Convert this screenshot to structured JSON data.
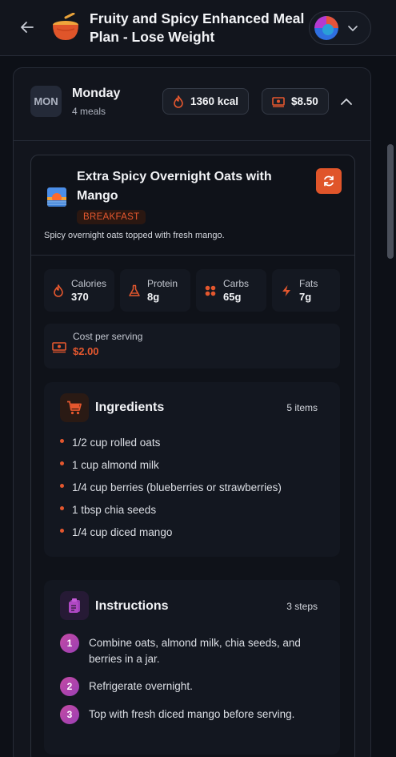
{
  "header": {
    "title": "Fruity and Spicy Enhanced Meal Plan - Lose Weight",
    "back_icon": "arrow-left-icon",
    "app_icon": "bowl-icon"
  },
  "day": {
    "badge": "MON",
    "name": "Monday",
    "meals": "4 meals",
    "calories": "1360 kcal",
    "cost": "$8.50"
  },
  "meal": {
    "title": "Extra Spicy Overnight Oats with Mango",
    "type": "BREAKFAST",
    "description": "Spicy overnight oats topped with fresh mango.",
    "stats": [
      {
        "label": "Calories",
        "value": "370",
        "icon": "flame-icon"
      },
      {
        "label": "Protein",
        "value": "8g",
        "icon": "flask-icon"
      },
      {
        "label": "Carbs",
        "value": "65g",
        "icon": "grid-icon"
      },
      {
        "label": "Fats",
        "value": "7g",
        "icon": "bolt-icon"
      }
    ],
    "cost_label": "Cost per serving",
    "cost_value": "$2.00"
  },
  "ingredients": {
    "title": "Ingredients",
    "count": "5 items",
    "items": [
      "1/2 cup rolled oats",
      "1 cup almond milk",
      "1/4 cup berries (blueberries or strawberries)",
      "1 tbsp chia seeds",
      "1/4 cup diced mango"
    ]
  },
  "instructions": {
    "title": "Instructions",
    "count": "3 steps",
    "steps": [
      {
        "num": "1",
        "text": "Combine oats, almond milk, chia seeds, and berries in a jar."
      },
      {
        "num": "2",
        "text": "Refrigerate overnight."
      },
      {
        "num": "3",
        "text": "Top with fresh diced mango before serving."
      }
    ]
  },
  "colors": {
    "accent": "#e4572e",
    "background": "#0d1017",
    "card": "#12151d",
    "step_gradient": "#b946ab"
  }
}
